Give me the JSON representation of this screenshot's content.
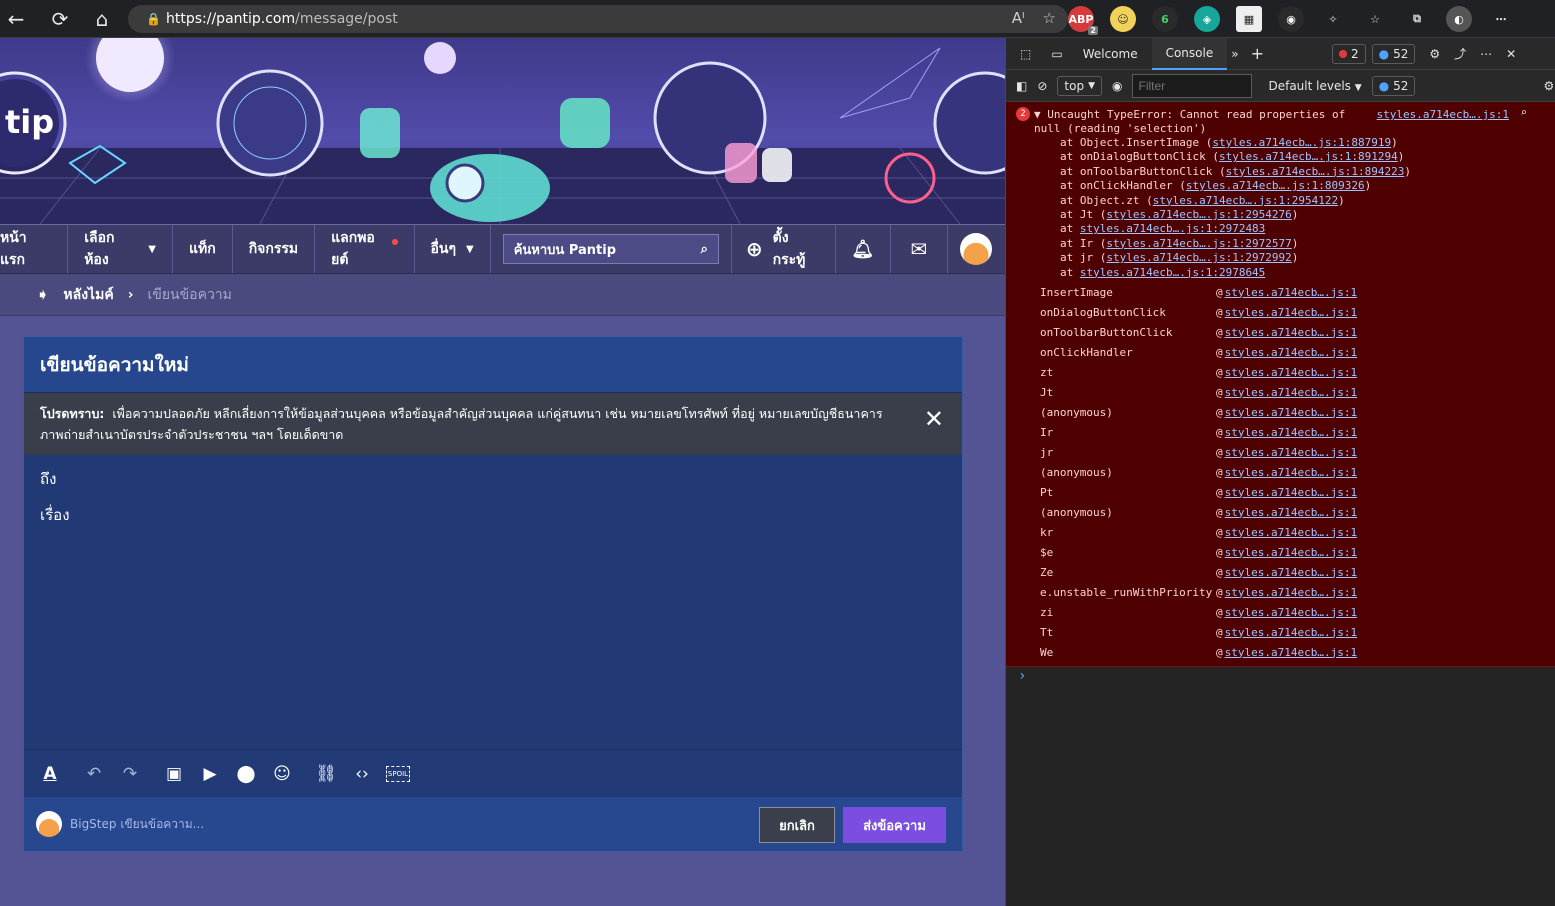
{
  "browser": {
    "url_host": "https://pantip.com",
    "url_path": "/message/post",
    "reader_label": "Aˡ"
  },
  "extensions": {
    "badge_count": "2"
  },
  "site": {
    "logo_text": "tip",
    "nav": {
      "home": "หน้าแรก",
      "rooms": "เลือกห้อง",
      "tags": "แท็ก",
      "activities": "กิจกรรม",
      "points": "แลกพอยต์",
      "more": "อื่นๆ",
      "search_placeholder": "ค้นหาบน Pantip",
      "new_topic": "ตั้งกระทู้"
    },
    "breadcrumb": {
      "home": "หลังไมค์",
      "current": "เขียนข้อความ"
    }
  },
  "composer": {
    "title": "เขียนข้อความใหม่",
    "notice_label": "โปรดทราบ:",
    "notice_text": "เพื่อความปลอดภัย หลีกเลี่ยงการให้ข้อมูลส่วนบุคคล หรือข้อมูลสำคัญส่วนบุคคล แก่คู่สนทนา เช่น หมายเลขโทรศัพท์ ที่อยู่ หมายเลขบัญชีธนาคาร ภาพถ่ายสำเนาบัตรประจำตัวประชาชน ฯลฯ โดยเด็ดขาด",
    "to_label": "ถึง",
    "subject_label": "เรื่อง",
    "typing_status": "BigStep เขียนข้อความ...",
    "cancel_label": "ยกเลิก",
    "send_label": "ส่งข้อความ",
    "spoil_label": "SPOIL"
  },
  "devtools": {
    "tabs": [
      "Welcome",
      "Console"
    ],
    "active_tab": "Console",
    "error_badge": "2",
    "info_badge": "52",
    "context": "top",
    "filter_placeholder": "Filter",
    "levels": "Default levels",
    "levels_badge": "52",
    "error": {
      "count": "2",
      "message": "Uncaught TypeError: Cannot read properties of null (reading 'selection')",
      "source": "styles.a714ecb….js:1",
      "stack": [
        {
          "prefix": "at Object.InsertImage (",
          "link": "styles.a714ecb….js:1:887919",
          "suffix": ")"
        },
        {
          "prefix": "at onDialogButtonClick (",
          "link": "styles.a714ecb….js:1:891294",
          "suffix": ")"
        },
        {
          "prefix": "at onToolbarButtonClick (",
          "link": "styles.a714ecb….js:1:894223",
          "suffix": ")"
        },
        {
          "prefix": "at onClickHandler (",
          "link": "styles.a714ecb….js:1:809326",
          "suffix": ")"
        },
        {
          "prefix": "at Object.zt (",
          "link": "styles.a714ecb….js:1:2954122",
          "suffix": ")"
        },
        {
          "prefix": "at Jt (",
          "link": "styles.a714ecb….js:1:2954276",
          "suffix": ")"
        },
        {
          "prefix": "at ",
          "link": "styles.a714ecb….js:1:2972483",
          "suffix": ""
        },
        {
          "prefix": "at Ir (",
          "link": "styles.a714ecb….js:1:2972577",
          "suffix": ")"
        },
        {
          "prefix": "at jr (",
          "link": "styles.a714ecb….js:1:2972992",
          "suffix": ")"
        },
        {
          "prefix": "at ",
          "link": "styles.a714ecb….js:1:2978645",
          "suffix": ""
        }
      ],
      "frames": [
        {
          "fn": "InsertImage",
          "link": "styles.a714ecb….js:1"
        },
        {
          "fn": "onDialogButtonClick",
          "link": "styles.a714ecb….js:1"
        },
        {
          "fn": "onToolbarButtonClick",
          "link": "styles.a714ecb….js:1"
        },
        {
          "fn": "onClickHandler",
          "link": "styles.a714ecb….js:1"
        },
        {
          "fn": "zt",
          "link": "styles.a714ecb….js:1"
        },
        {
          "fn": "Jt",
          "link": "styles.a714ecb….js:1"
        },
        {
          "fn": "(anonymous)",
          "link": "styles.a714ecb….js:1"
        },
        {
          "fn": "Ir",
          "link": "styles.a714ecb….js:1"
        },
        {
          "fn": "jr",
          "link": "styles.a714ecb….js:1"
        },
        {
          "fn": "(anonymous)",
          "link": "styles.a714ecb….js:1"
        },
        {
          "fn": "Pt",
          "link": "styles.a714ecb….js:1"
        },
        {
          "fn": "(anonymous)",
          "link": "styles.a714ecb….js:1"
        },
        {
          "fn": "kr",
          "link": "styles.a714ecb….js:1"
        },
        {
          "fn": "$e",
          "link": "styles.a714ecb….js:1"
        },
        {
          "fn": "Ze",
          "link": "styles.a714ecb….js:1"
        },
        {
          "fn": "e.unstable_runWithPriority",
          "link": "styles.a714ecb….js:1"
        },
        {
          "fn": "zi",
          "link": "styles.a714ecb….js:1"
        },
        {
          "fn": "Tt",
          "link": "styles.a714ecb….js:1"
        },
        {
          "fn": "We",
          "link": "styles.a714ecb….js:1"
        }
      ]
    },
    "prompt": "›"
  }
}
